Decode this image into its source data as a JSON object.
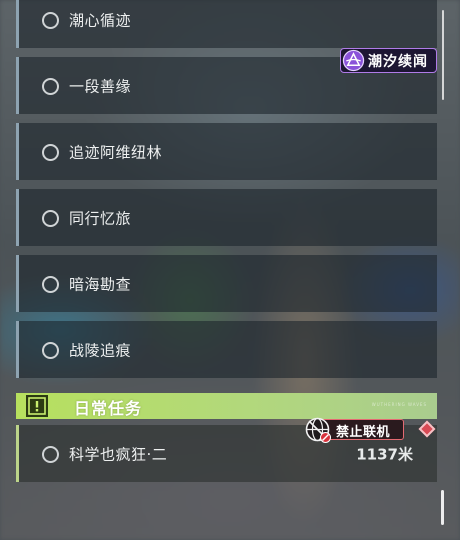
{
  "quests": [
    {
      "label": "潮心循迹"
    },
    {
      "label": "一段善缘"
    },
    {
      "label": "追迹阿维纽林"
    },
    {
      "label": "同行忆旅"
    },
    {
      "label": "暗海勘查"
    },
    {
      "label": "战陵追痕"
    }
  ],
  "chaoxi_badge": {
    "label": "潮汐续闻",
    "icon": "chaoxi-emblem-icon"
  },
  "daily": {
    "header": "日常任务",
    "header_icon": "exclamation-icon",
    "watermark": "WUTHERING WAVES",
    "quest_label": "科学也疯狂·二",
    "distance": "1137米"
  },
  "multiplayer_badge": {
    "label": "禁止联机",
    "icon": "no-multiplayer-globe-icon"
  },
  "colors": {
    "quest_border": "#8ea3b1",
    "daily_green": "#b7e05e",
    "chaoxi_purple": "#b07be8",
    "multiplayer_red": "#e46a72"
  }
}
